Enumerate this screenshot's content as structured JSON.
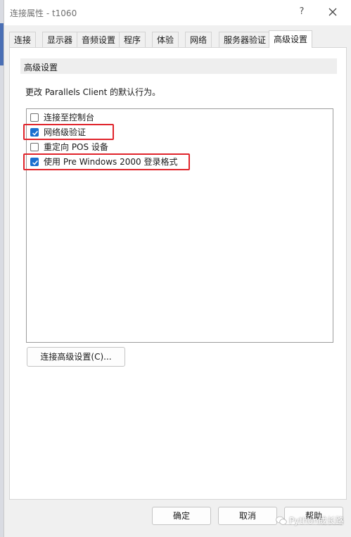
{
  "window": {
    "title": "连接属性 - t1060",
    "help_symbol": "?"
  },
  "tabs": [
    {
      "label": "连接"
    },
    {
      "label": "显示器"
    },
    {
      "label": "音频设置"
    },
    {
      "label": "程序"
    },
    {
      "label": "体验"
    },
    {
      "label": "网络"
    },
    {
      "label": "服务器验证"
    },
    {
      "label": "高级设置",
      "active": true
    }
  ],
  "panel": {
    "section_title": "高级设置",
    "description": "更改 Parallels Client 的默认行为。",
    "options": [
      {
        "label": "连接至控制台",
        "checked": false,
        "highlighted": false
      },
      {
        "label": "网络级验证",
        "checked": true,
        "highlighted": true
      },
      {
        "label": "重定向 POS 设备",
        "checked": false,
        "highlighted": false
      },
      {
        "label": "使用 Pre Windows 2000 登录格式",
        "checked": true,
        "highlighted": true
      }
    ],
    "advanced_button": "连接高级设置(C)..."
  },
  "footer": {
    "ok": "确定",
    "cancel": "取消",
    "help": "帮助"
  },
  "watermark": {
    "text": "Python成长路"
  },
  "colors": {
    "checkbox_checked": "#1a6fd0",
    "highlight_box": "#e0242b",
    "window_bg": "#f0f0f0"
  }
}
